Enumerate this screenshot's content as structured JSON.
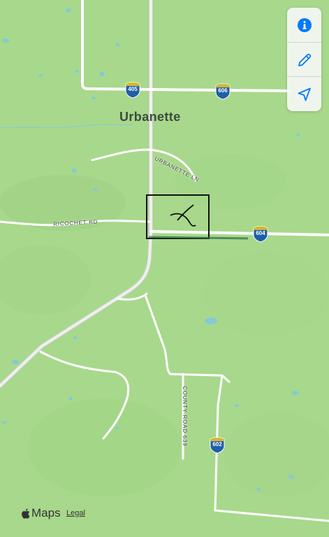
{
  "map": {
    "place_label": "Urbanette",
    "road_labels": {
      "urbanette_ln": "URBANETTE LN",
      "ricochet_rd": "RICOCHET RD",
      "county_road_639": "COUNTY ROAD 639"
    },
    "route_shields": [
      "405",
      "606",
      "604",
      "602"
    ]
  },
  "controls": {
    "info_icon": "info-icon",
    "edit_icon": "pencil-icon",
    "locate_icon": "location-arrow-icon"
  },
  "brand": {
    "text": "Maps",
    "legal": "Legal"
  },
  "colors": {
    "land": "#a8d88c",
    "road": "#ffffff",
    "water": "#7ec8e3",
    "shield": "#1f5fa8",
    "accent": "#007aff"
  }
}
